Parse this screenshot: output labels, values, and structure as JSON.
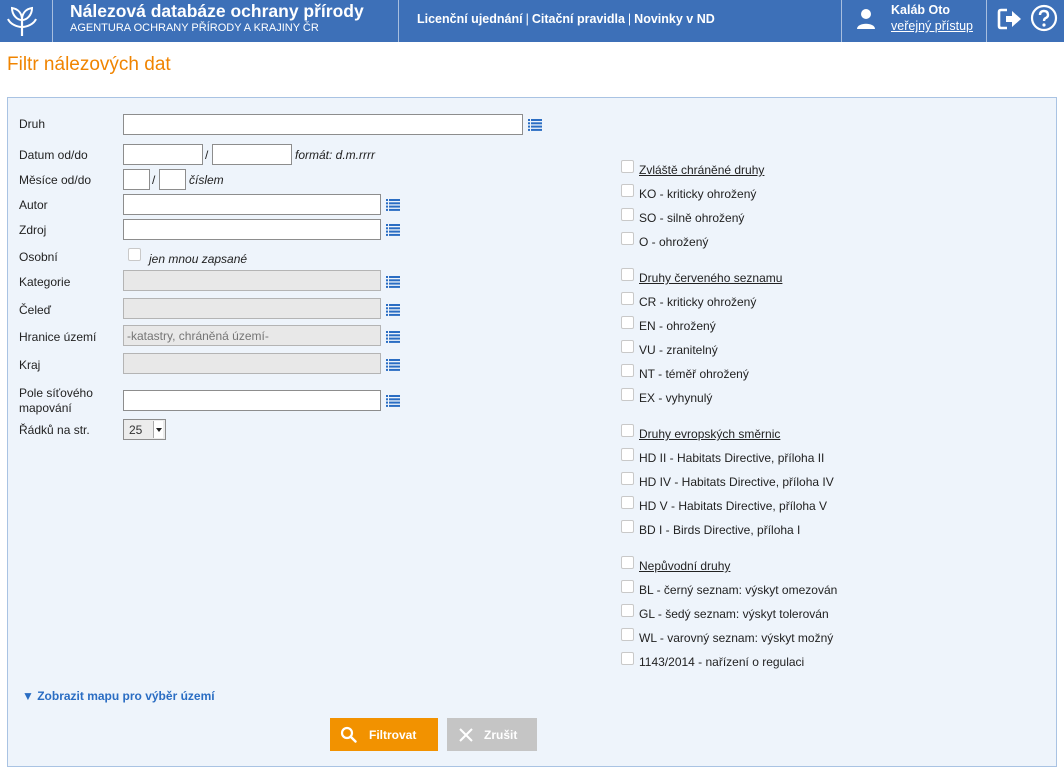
{
  "header": {
    "title": "Nálezová databáze ochrany přírody",
    "subtitle": "AGENTURA OCHRANY PŘÍRODY A KRAJINY ČR",
    "nav": [
      "Licenční ujednání",
      "Citační pravidla",
      "Novinky v ND"
    ],
    "separator": "|",
    "user": {
      "name": "Kaláb Oto",
      "access": "veřejný přístup"
    }
  },
  "page_title": "Filtr nálezových dat",
  "form": {
    "druh": {
      "label": "Druh",
      "value": ""
    },
    "datum": {
      "label": "Datum od/do",
      "from": "",
      "to": "",
      "separator": "/",
      "hint": "formát: d.m.rrrr"
    },
    "mesice": {
      "label": "Měsíce od/do",
      "from": "",
      "to": "",
      "separator": "/",
      "hint": "číslem"
    },
    "autor": {
      "label": "Autor",
      "value": ""
    },
    "zdroj": {
      "label": "Zdroj",
      "value": ""
    },
    "osobni": {
      "label": "Osobní",
      "checkbox_label": "jen mnou zapsané"
    },
    "kategorie": {
      "label": "Kategorie",
      "value": ""
    },
    "celed": {
      "label": "Čeleď",
      "value": ""
    },
    "hranice": {
      "label": "Hranice území",
      "placeholder": "-katastry, chráněná území-"
    },
    "kraj": {
      "label": "Kraj",
      "value": ""
    },
    "pole": {
      "label_line1": "Pole síťového",
      "label_line2": "mapování",
      "value": ""
    },
    "radku": {
      "label": "Řádků na str.",
      "value": "25"
    }
  },
  "protection": {
    "groups": [
      {
        "title": "Zvláště chráněné druhy",
        "items": [
          "KO - kriticky ohrožený",
          "SO - silně ohrožený",
          "O - ohrožený"
        ]
      },
      {
        "title": "Druhy červeného seznamu",
        "items": [
          "CR - kriticky ohrožený",
          "EN - ohrožený",
          "VU - zranitelný",
          "NT - téměř ohrožený",
          "EX - vyhynulý"
        ]
      },
      {
        "title": "Druhy evropských směrnic",
        "items": [
          "HD II - Habitats Directive, příloha II",
          "HD IV - Habitats Directive, příloha IV",
          "HD V - Habitats Directive, příloha V",
          "BD I - Birds Directive, příloha I"
        ]
      },
      {
        "title": "Nepůvodní druhy",
        "items": [
          "BL - černý seznam: výskyt omezován",
          "GL - šedý seznam: výskyt tolerován",
          "WL - varovný seznam: výskyt možný",
          "1143/2014 - nařízení o regulaci"
        ]
      }
    ]
  },
  "map_link": "▼ Zobrazit mapu pro výběr území",
  "buttons": {
    "filter": "Filtrovat",
    "cancel": "Zrušit"
  },
  "colors": {
    "header_bg": "#3d70b8",
    "accent": "#f08400",
    "filter_button": "#f29200",
    "cancel_button": "#c5c5c5",
    "panel_bg": "#eef4fb",
    "link": "#2a6dc3"
  }
}
